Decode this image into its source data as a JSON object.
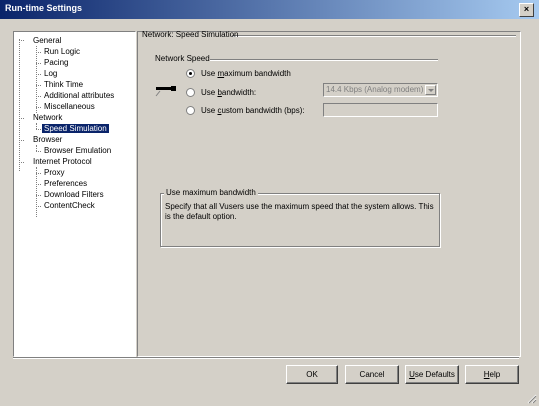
{
  "window": {
    "title": "Run-time Settings",
    "close_glyph": "×"
  },
  "tree": {
    "general": "General",
    "general_children": [
      "Run Logic",
      "Pacing",
      "Log",
      "Think Time",
      "Additional attributes",
      "Miscellaneous"
    ],
    "network": "Network",
    "network_children": [
      "Speed Simulation"
    ],
    "browser": "Browser",
    "browser_children": [
      "Browser Emulation"
    ],
    "internet": "Internet Protocol",
    "internet_children": [
      "Proxy",
      "Preferences",
      "Download Filters",
      "ContentCheck"
    ]
  },
  "panel": {
    "title": "Network: Speed Simulation",
    "section_label": "Network Speed",
    "options": [
      {
        "pre": "Use ",
        "key": "m",
        "post": "aximum bandwidth",
        "selected": true
      },
      {
        "pre": "Use ",
        "key": "b",
        "post": "andwidth:",
        "selected": false
      },
      {
        "pre": "Use ",
        "key": "c",
        "post": "ustom bandwidth (bps):",
        "selected": false
      }
    ],
    "bandwidth_value": "14.4 Kbps (Analog modem)",
    "custom_value": "",
    "desc_title": "Use maximum bandwidth",
    "desc_text": "Specify that all Vusers use the maximum speed that the system allows. This is the default option."
  },
  "buttons": {
    "ok": "OK",
    "cancel": "Cancel",
    "defaults_key": "U",
    "defaults_rest": "se Defaults",
    "help_key": "H",
    "help_rest": "elp"
  },
  "colors": {
    "titlebar_start": "#0a246a",
    "titlebar_end": "#a6caf0",
    "selection": "#0a246a",
    "dialog": "#d4d0c8"
  }
}
